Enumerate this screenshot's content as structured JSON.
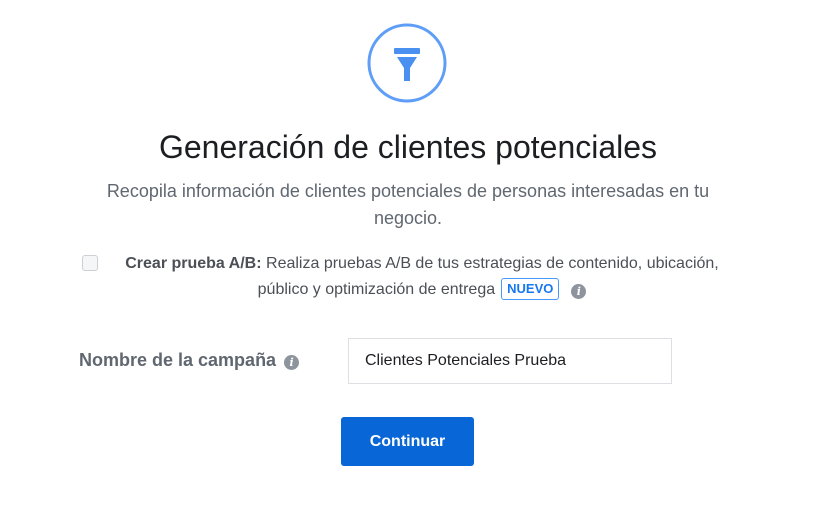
{
  "objective": {
    "icon": "funnel-icon",
    "title": "Generación de clientes potenciales",
    "description": "Recopila información de clientes potenciales de personas interesadas en tu negocio."
  },
  "ab_test": {
    "checked": false,
    "label": "Crear prueba A/B:",
    "text": " Realiza pruebas A/B de tus estrategias de contenido, ubicación, público y optimización de entrega",
    "badge": "NUEVO",
    "info_icon": "info-icon"
  },
  "campaign_name": {
    "label": "Nombre de la campaña",
    "info_icon": "info-icon",
    "value": "Clientes Potenciales Prueba"
  },
  "continue_label": "Continuar",
  "colors": {
    "accent": "#1877f2",
    "button": "#0866d6",
    "icon_ring": "#5f9ef7"
  }
}
